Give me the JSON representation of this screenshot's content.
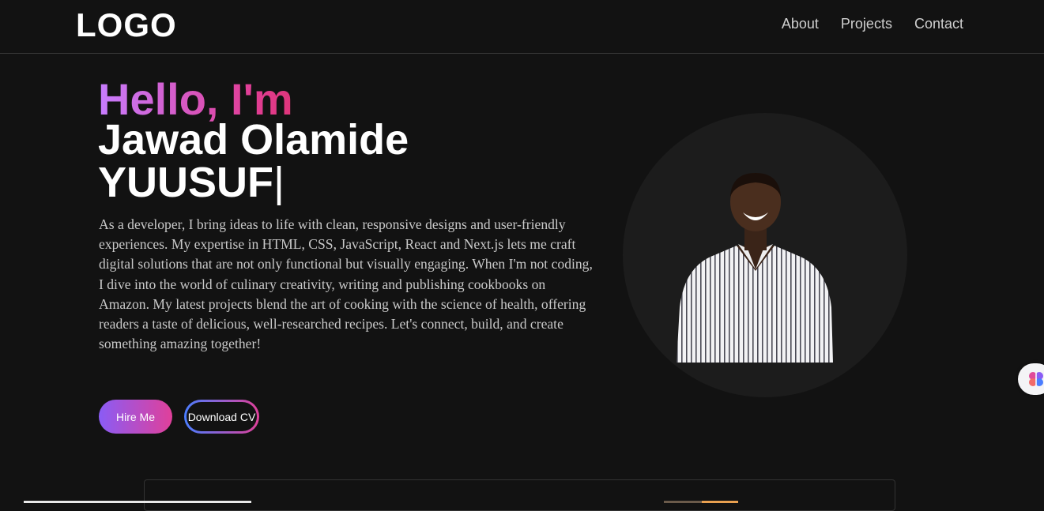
{
  "nav": {
    "logo": "LOGO",
    "links": [
      "About",
      "Projects",
      "Contact"
    ]
  },
  "hero": {
    "greeting": "Hello, I'm",
    "name": "Jawad Olamide YUUSUF",
    "cursor": "|",
    "bio": "As a developer, I bring ideas to life with clean, responsive designs and user-friendly experiences. My expertise in HTML, CSS, JavaScript, React and Next.js lets me craft digital solutions that are not only functional but visually engaging. When I'm not coding, I dive into the world of culinary creativity, writing and publishing cookbooks on Amazon. My latest projects blend the art of cooking with the science of health, offering readers a taste of delicious, well-researched recipes. Let's connect, build, and create something amazing together!",
    "hire_label": "Hire Me",
    "cv_label": "Download CV"
  },
  "colors": {
    "background": "#121212",
    "gradient_start": "#c77dff",
    "gradient_end": "#e0409a",
    "button_gradient_start": "#8a5cf5",
    "cv_border_start": "#4a7dff"
  },
  "icons": {
    "side_widget": "brain-icon"
  }
}
